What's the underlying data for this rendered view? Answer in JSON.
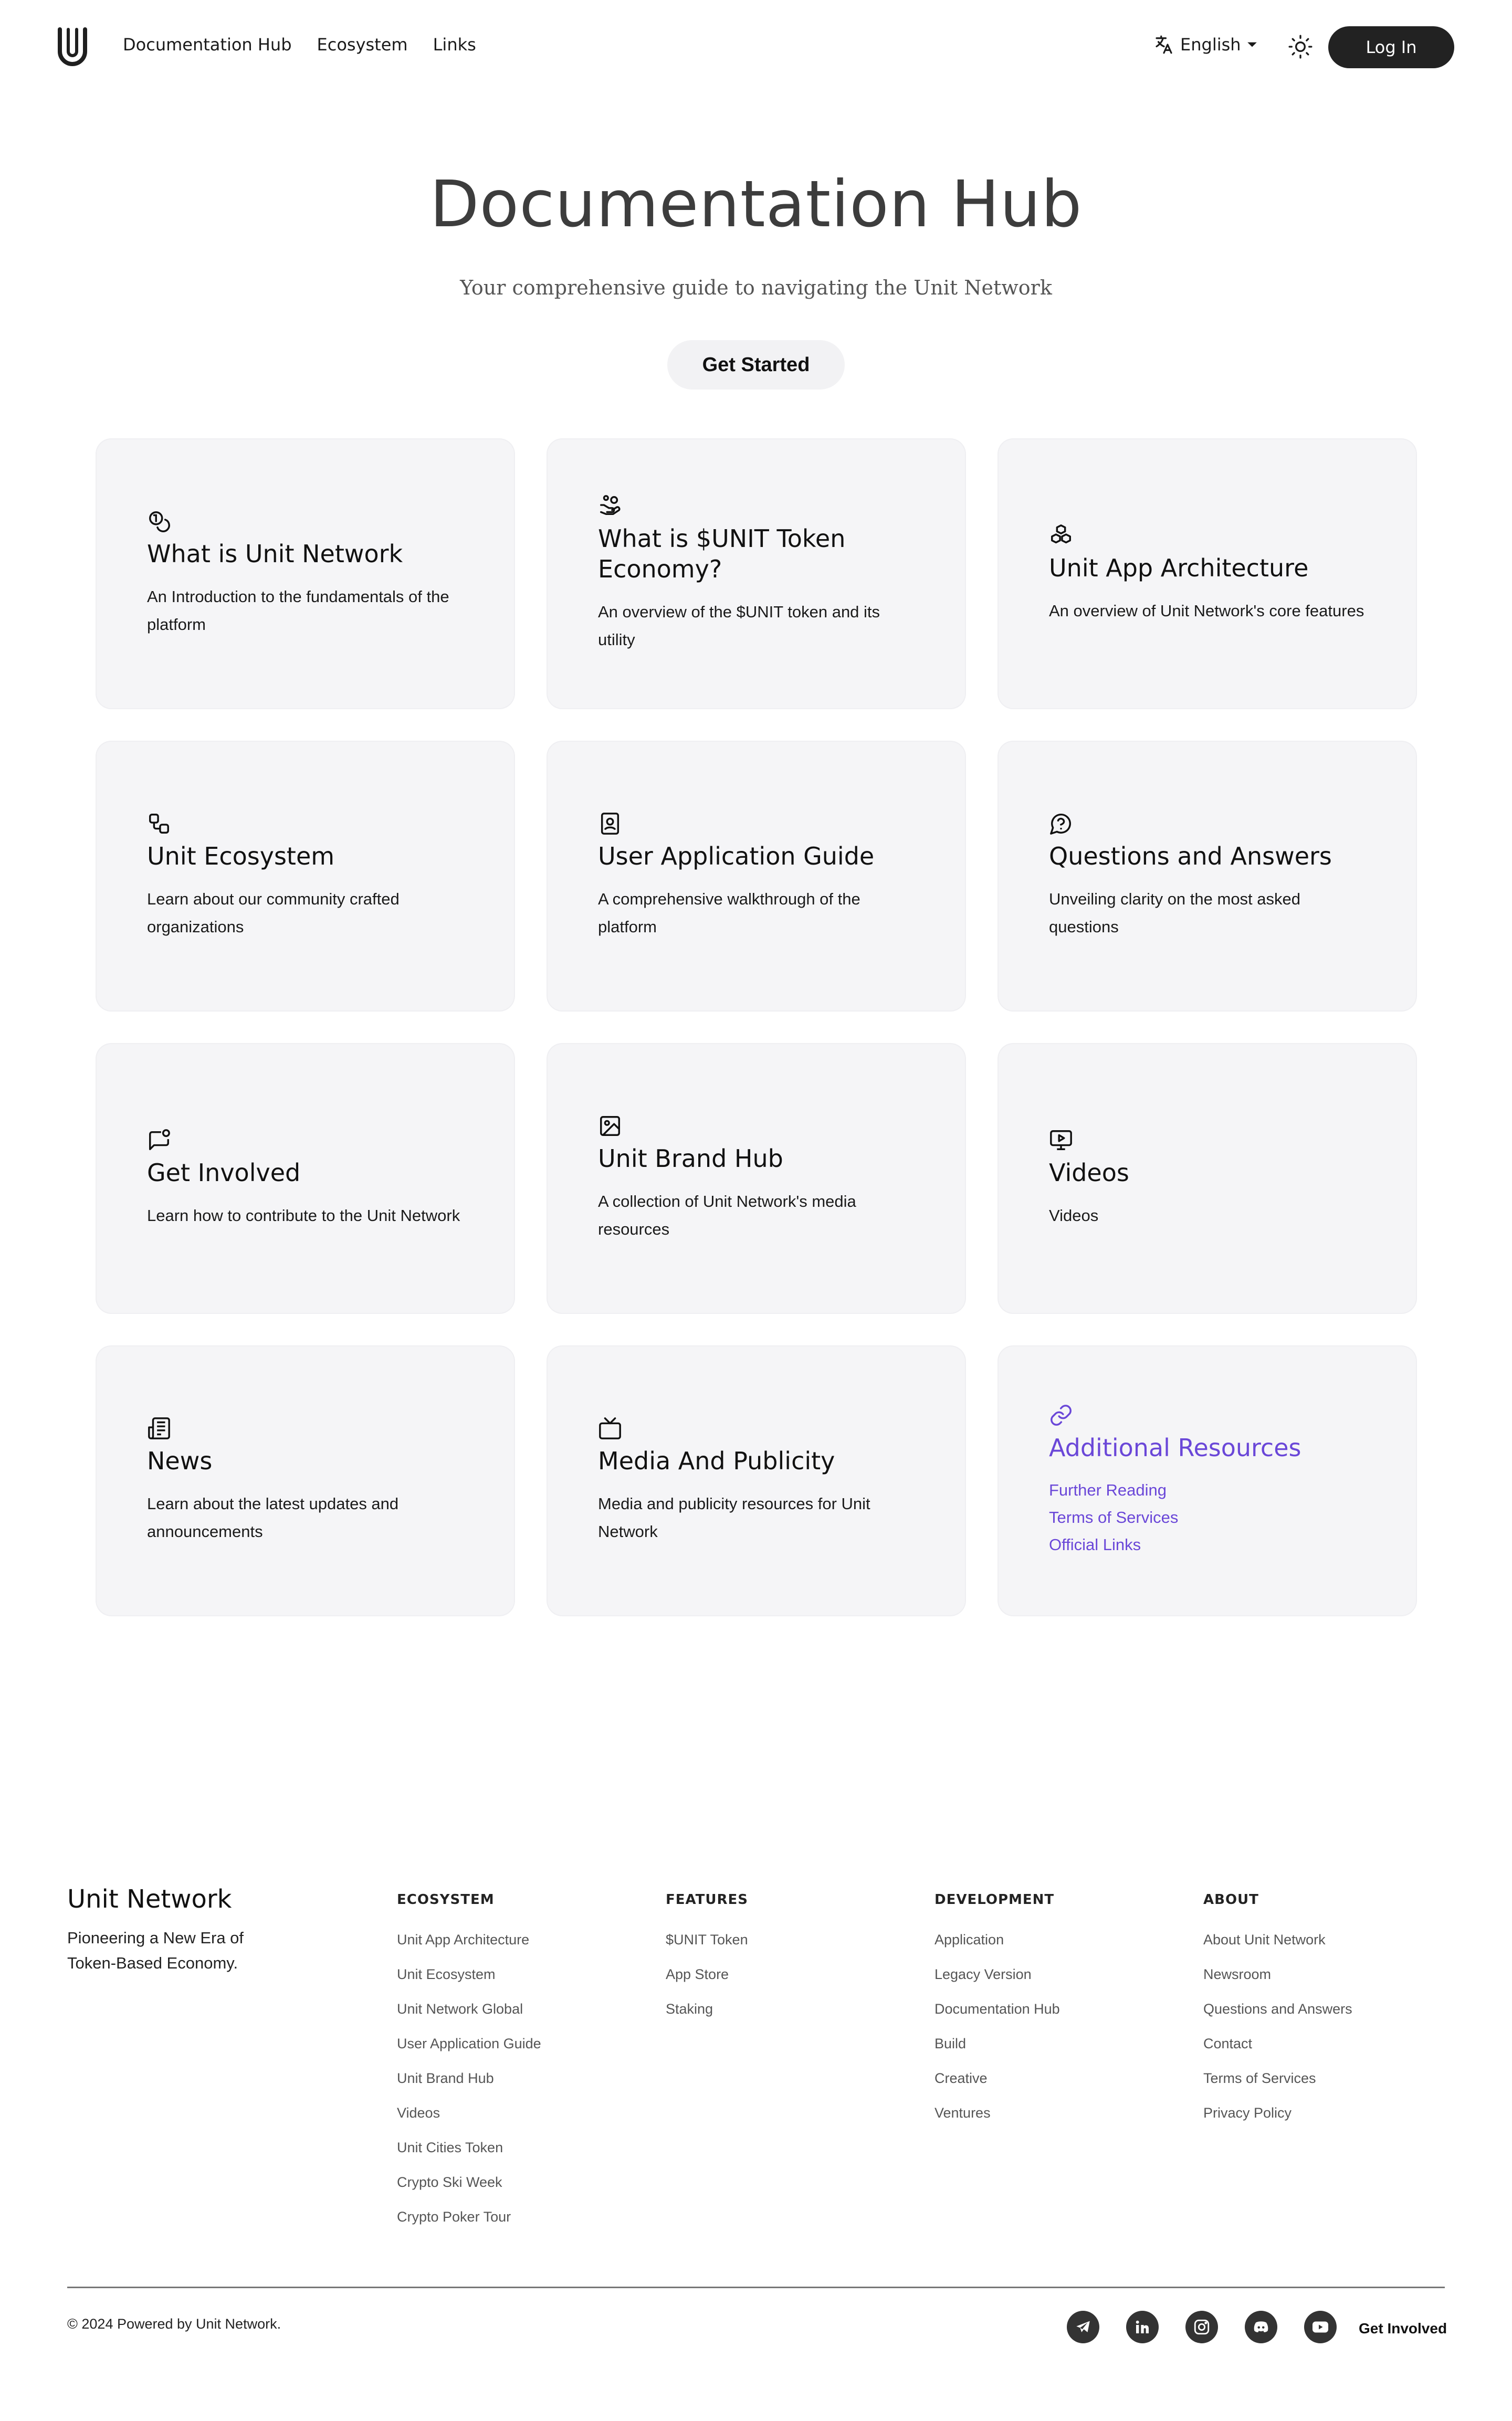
{
  "header": {
    "nav": [
      "Documentation Hub",
      "Ecosystem",
      "Links"
    ],
    "language": "English",
    "login_label": "Log In"
  },
  "hero": {
    "title": "Documentation Hub",
    "subtitle": "Your comprehensive guide to navigating the Unit Network",
    "button": "Get Started"
  },
  "cards": [
    {
      "icon": "coins-icon",
      "title": "What is Unit Network",
      "desc": "An Introduction to the fundamentals of the platform"
    },
    {
      "icon": "hand-coins-icon",
      "title": "What is $UNIT Token Economy?",
      "desc": "An overview of the $UNIT token and its utility"
    },
    {
      "icon": "cubes-icon",
      "title": "Unit App Architecture",
      "desc": "An overview of Unit Network's core features"
    },
    {
      "icon": "workflow-icon",
      "title": "Unit Ecosystem",
      "desc": "Learn about our community crafted organizations"
    },
    {
      "icon": "contact-book-icon",
      "title": "User Application Guide",
      "desc": "A comprehensive walkthrough of the platform"
    },
    {
      "icon": "question-bubble-icon",
      "title": "Questions and Answers",
      "desc": "Unveiling clarity on the most asked questions"
    },
    {
      "icon": "message-dot-icon",
      "title": "Get Involved",
      "desc": "Learn how to contribute to the Unit Network"
    },
    {
      "icon": "image-icon",
      "title": "Unit Brand Hub",
      "desc": "A collection of Unit Network's media resources"
    },
    {
      "icon": "monitor-play-icon",
      "title": "Videos",
      "desc": "Videos"
    },
    {
      "icon": "newspaper-icon",
      "title": "News",
      "desc": "Learn about the latest updates and announcements"
    },
    {
      "icon": "tv-icon",
      "title": "Media And Publicity",
      "desc": "Media and publicity resources for Unit Network"
    }
  ],
  "additional": {
    "icon": "link-icon",
    "title": "Additional Resources",
    "links": [
      "Further Reading",
      "Terms of Services",
      "Official Links"
    ],
    "accent": "#6a47d8"
  },
  "footer": {
    "brand": "Unit Network",
    "tagline": "Pioneering a New Era of Token-Based Economy.",
    "columns": [
      {
        "heading": "ECOSYSTEM",
        "links": [
          "Unit App Architecture",
          "Unit Ecosystem",
          "Unit Network Global",
          "User Application Guide",
          "Unit Brand Hub",
          "Videos",
          "Unit Cities Token",
          "Crypto Ski Week",
          "Crypto Poker Tour"
        ]
      },
      {
        "heading": "FEATURES",
        "links": [
          "$UNIT Token",
          "App Store",
          "Staking"
        ]
      },
      {
        "heading": "DEVELOPMENT",
        "links": [
          "Application",
          "Legacy Version",
          "Documentation Hub",
          "Build",
          "Creative",
          "Ventures"
        ]
      },
      {
        "heading": "ABOUT",
        "links": [
          "About Unit Network",
          "Newsroom",
          "Questions and Answers",
          "Contact",
          "Terms of Services",
          "Privacy Policy"
        ]
      }
    ],
    "copyright": "© 2024 Powered by Unit Network.",
    "socials": [
      "telegram-icon",
      "linkedin-icon",
      "instagram-icon",
      "discord-icon",
      "youtube-icon"
    ],
    "get_involved": "Get Involved"
  }
}
